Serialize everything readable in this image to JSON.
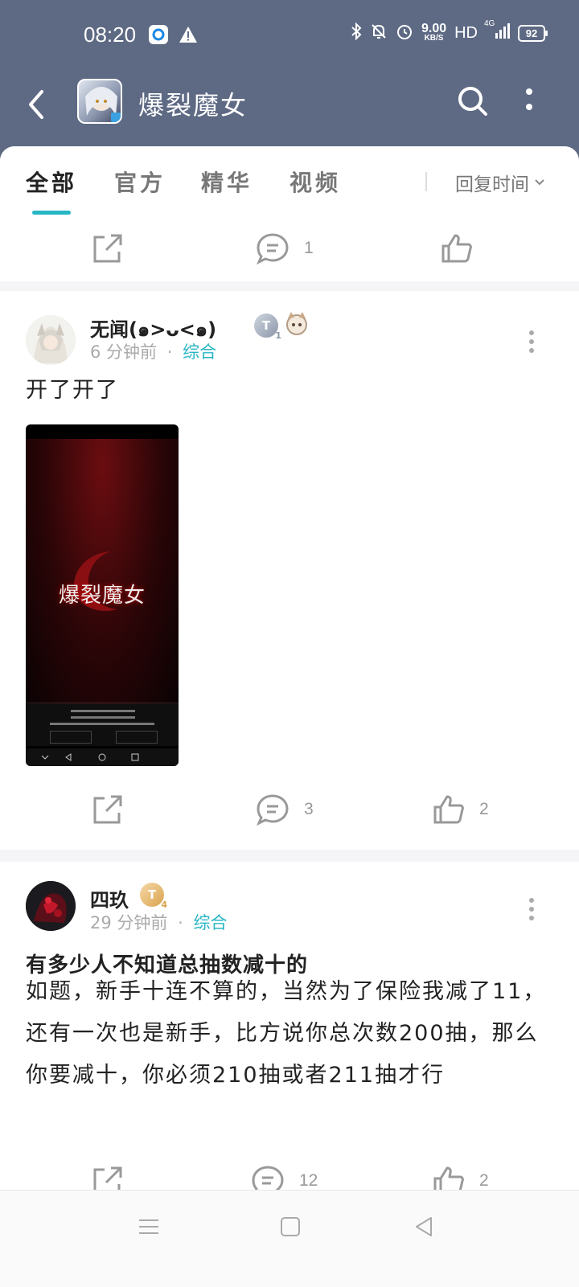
{
  "status_bar": {
    "time": "08:20",
    "speed_value": "9.00",
    "speed_unit": "KB/S",
    "hd": "HD",
    "network": "4G",
    "battery": "92"
  },
  "app_bar": {
    "title": "爆裂魔女"
  },
  "tabs": {
    "items": [
      "全部",
      "官方",
      "精华",
      "视频"
    ],
    "active_index": 0,
    "sort_label": "回复时间"
  },
  "first_card": {
    "comments": "1",
    "likes": ""
  },
  "posts": [
    {
      "user": "无闻(๑>ᴗ<๑)",
      "badge": "T",
      "badge_level": "1",
      "time": "6 分钟前",
      "separator": "·",
      "category": "综合",
      "text": "开了开了",
      "image_text": {
        "logo": "爆裂魔女"
      },
      "comments": "3",
      "likes": "2"
    },
    {
      "user": "四玖",
      "badge": "T",
      "badge_level": "4",
      "time": "29 分钟前",
      "separator": "·",
      "category": "综合",
      "title": "有多少人不知道总抽数减十的",
      "text": "如题，新手十连不算的，当然为了保险我减了11，还有一次也是新手，比方说你总次数200抽，那么你要减十，你必须210抽或者211抽才行",
      "comments": "12",
      "likes": "2"
    }
  ],
  "colors": {
    "accent": "#27b6c4",
    "header_bg": "#5e6a84"
  }
}
